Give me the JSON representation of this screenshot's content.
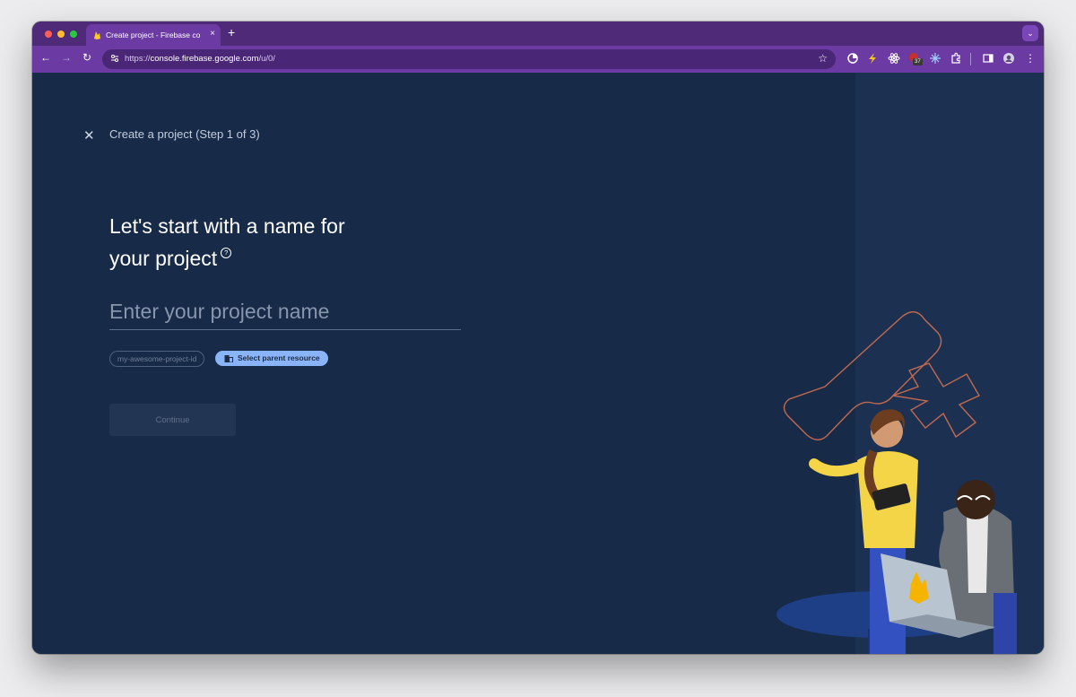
{
  "browser": {
    "tab": {
      "title": "Create project - Firebase co",
      "close_symbol": "×"
    },
    "new_tab_symbol": "+",
    "tab_menu_symbol": "⌄",
    "nav": {
      "back": "←",
      "forward": "→",
      "reload": "↻"
    },
    "url": {
      "scheme": "https://",
      "host": "console.firebase.google.com",
      "path": "/u/0/"
    },
    "bookmark_symbol": "☆",
    "extension_badge": "37",
    "menu_symbol": "⋮"
  },
  "page": {
    "close_symbol": "✕",
    "step_label": "Create a project (Step 1 of 3)",
    "heading_line1": "Let's start with a name for",
    "heading_line2": "your project",
    "help_symbol": "?",
    "project_name_placeholder": "Enter your project name",
    "project_id_chip": "my-awesome-project-id",
    "parent_resource_button": "Select parent resource",
    "continue_button": "Continue"
  },
  "colors": {
    "browser_frame": "#4e2a78",
    "toolbar": "#6b3aa3",
    "page_background": "#172a47",
    "accent_chip": "#8ab4f8",
    "decorative_outline": "#c0694f"
  }
}
